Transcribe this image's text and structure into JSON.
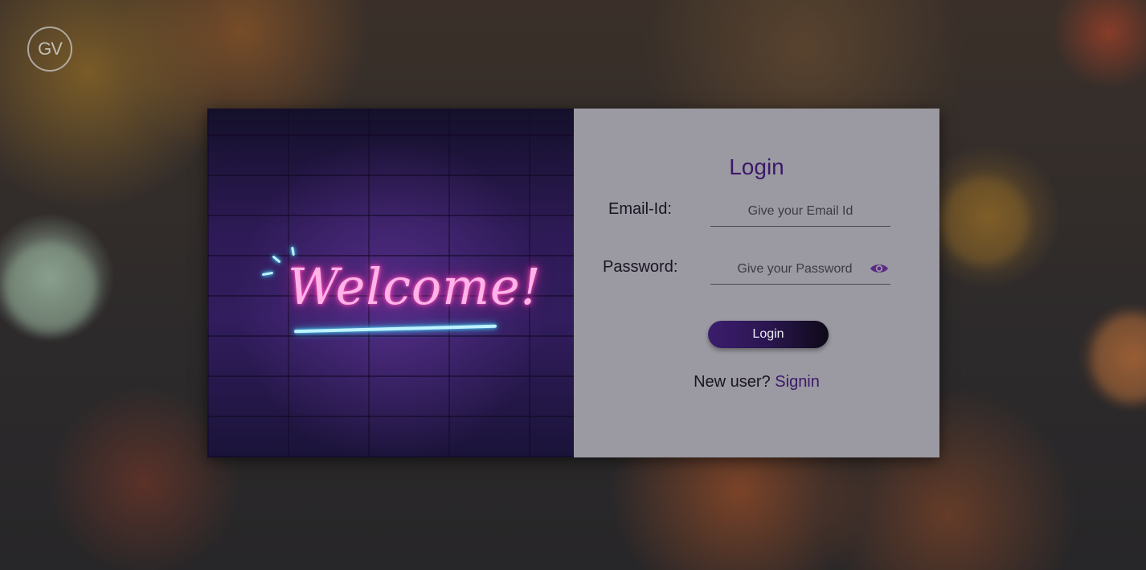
{
  "brand": {
    "logo_text": "GV"
  },
  "hero": {
    "neon_text": "Welcome!"
  },
  "login_form": {
    "title": "Login",
    "email": {
      "label": "Email-Id:",
      "value": "",
      "placeholder": "Give your Email Id"
    },
    "password": {
      "label": "Password:",
      "value": "",
      "placeholder": "Give your Password",
      "toggle_icon": "eye-icon"
    },
    "submit_label": "Login",
    "signup_prompt": "New user?",
    "signup_link": "Signin"
  },
  "colors": {
    "accent": "#3c1869",
    "panel_bg": "#9b9aa2",
    "button_start": "#3b1d6c",
    "button_end": "#0e0a17",
    "neon_pink": "#ff4fc4",
    "neon_blue": "#50e0ff"
  }
}
